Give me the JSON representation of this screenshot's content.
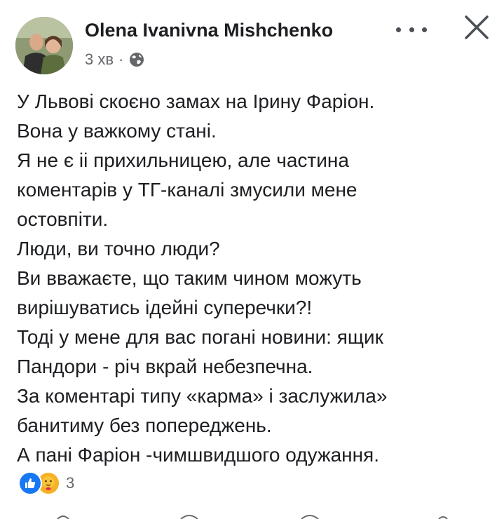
{
  "post": {
    "author": "Olena Ivanivna Mishchenko",
    "time": "3 хв",
    "separator": "·",
    "privacy_icon": "globe-icon",
    "lines": [
      "У Львові скоєно замах на Ірину Фаріон.",
      "Вона у важкому стані.",
      "Я не є іі прихильницею, але частина",
      "коментарів у ТГ-каналі змусили мене",
      "остовпіти.",
      "Люди, ви точно люди?",
      "Ви вважаєте, що таким чином можуть",
      "вирішуватись ідейні суперечки?!",
      "Тоді у мене для вас погані новини: ящик",
      "Пандори - річ вкрай небезпечна.",
      "За коментарі типу «карма» і заслужила»",
      "банитиму без попереджень.",
      "А пані Фаріон -чимшвидшого одужання."
    ]
  },
  "reactions": {
    "icons": [
      "like-icon",
      "care-icon"
    ],
    "count": "3"
  },
  "colors": {
    "text": "#1c1e21",
    "secondary": "#65676b",
    "like_blue": "#1877f2",
    "care_yellow": "#f7b125"
  }
}
